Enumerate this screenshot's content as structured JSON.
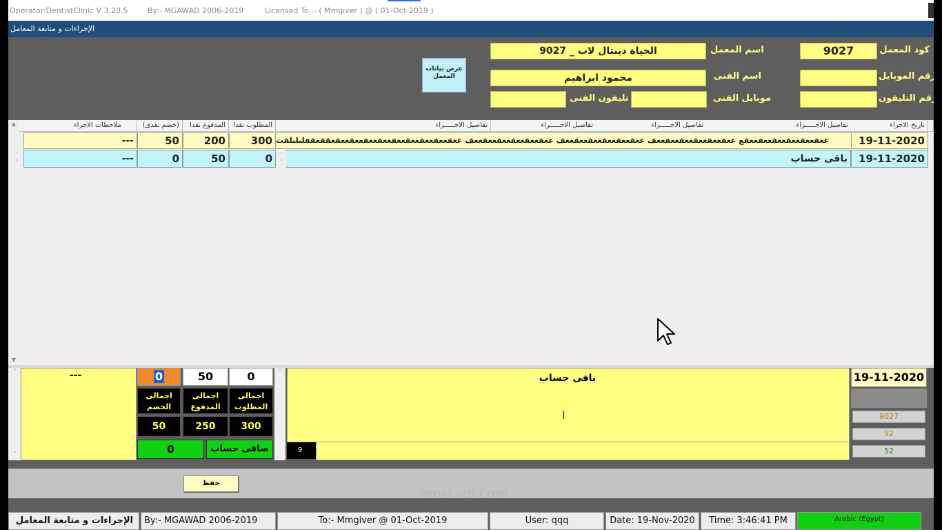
{
  "window": {
    "app_title": "Operator-DentistClinic V 3.20.5",
    "author": "By:- MGAWAD 2006-2019",
    "license": "Licensed To :- ( Mmgiver ) @ ( 01-Oct-2019 )"
  },
  "form_title": "الإجراءات و متابعة المعامل",
  "header": {
    "lab_code_label": "كود المعمل",
    "lab_code_value": "9027",
    "lab_name_label": "اسم المعمل",
    "lab_name_value": "الحياة دينتال لاب _ 9027",
    "mobile_label": "رقم الموبايل",
    "mobile_value": "",
    "tech_name_label": "اسم الفنى",
    "tech_name_value": "محمود ابراهيم",
    "phone_label": "رقم التليفون",
    "phone_value": "",
    "tech_mobile_label": "موبايل الفنى",
    "tech_mobile_value": "",
    "tech_phone_label": "تليفون الفنى",
    "tech_phone_value": "",
    "show_lab_button": "عرض بيانات المعمل"
  },
  "grid": {
    "columns": {
      "date": "تاريخ الاجراء",
      "details1": "تفاصيل الاجـــــراء",
      "details2": "تفاصيل الاجـــــراء",
      "details3": "تفاصيل الاجـــــراء",
      "details4": "تفاصيل الاجـــــراء",
      "required": "المطلوب نقدا",
      "paid": "المدفوع نقدا",
      "discount": "(خصم نقدى)",
      "notes": "ملاحظات الاجراء"
    },
    "rows": [
      {
        "date": "19-11-2020",
        "details": "عغفغعفغعفغعفغعفغعفع عغفغعفغعفغعفغعفغعف عغفغعفغعفغعفغعفغعف عغفغعفغعفغعفغعفغعف عغفغعفغعفغعفغعفغعفغعفغعفغعفغقفغقفلبلبلقث",
        "required": "300",
        "paid": "200",
        "discount": "50",
        "notes": "---"
      },
      {
        "date": "19-11-2020",
        "details": "باقى حساب",
        "required": "0",
        "paid": "50",
        "discount": "0",
        "notes": "---"
      }
    ]
  },
  "summary": {
    "date": "19-11-2020",
    "details": "باقى حساب",
    "required": "0",
    "paid": "50",
    "discount": "0",
    "notes": "---",
    "total_required_label": "اجمالى المطلوب",
    "total_paid_label": "اجمالى المدفوع",
    "total_discount_label": "اجمالى الخصم",
    "total_required": "300",
    "total_paid": "250",
    "total_discount": "50",
    "net_label": "صافى حساب",
    "net_value": "0",
    "record_count": "9",
    "side_values": [
      "9027",
      "52",
      "52"
    ]
  },
  "save_button": "حفظ",
  "watermark": "mostaql.com",
  "status": {
    "form": "الإجراءات و متابعة المعامل",
    "author": "By:- MGAWAD 2006-2019",
    "license": "To:- Mmgiver @ 01-Oct-2019",
    "user": "User: qqq",
    "date": "Date: 19-Nov-2020",
    "time": "Time: 3:46:41 PM",
    "language": "Arabic (Egypt)"
  },
  "colors": {
    "field_yellow": "#fffe80",
    "label_yellow": "#ffff80",
    "row_cyan": "#c2f5fa",
    "navy": "#1f4e79",
    "green": "#11d011",
    "orange": "#f08a2c"
  }
}
